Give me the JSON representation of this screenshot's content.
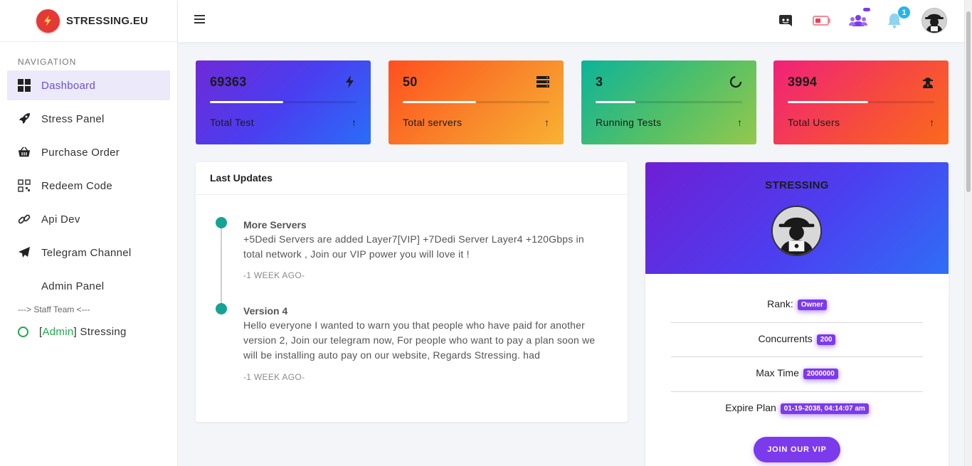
{
  "brand": {
    "name": "STRESSING.EU",
    "logo_icon": "lightning-icon",
    "logo_color": "#e53935"
  },
  "nav": {
    "title": "NAVIGATION",
    "items": [
      {
        "label": "Dashboard",
        "icon": "grid-icon",
        "active": true
      },
      {
        "label": "Stress Panel",
        "icon": "rocket-icon"
      },
      {
        "label": "Purchase Order",
        "icon": "basket-icon"
      },
      {
        "label": "Redeem Code",
        "icon": "qr-icon"
      },
      {
        "label": "Api Dev",
        "icon": "link-icon"
      },
      {
        "label": "Telegram Channel",
        "icon": "paper-plane-icon"
      },
      {
        "label": "Admin Panel",
        "icon": ""
      }
    ],
    "staff_title": "---> Staff Team <---",
    "staff_member": {
      "prefix_open": "[",
      "role": "Admin",
      "prefix_close": "]",
      "name": " Stressing",
      "status_color": "#20a84a"
    }
  },
  "topbar": {
    "icons": [
      "discord-icon",
      "battery-icon",
      "users-icon",
      "bell-icon",
      "avatar"
    ],
    "notification_count": "1"
  },
  "stats": [
    {
      "value": "69363",
      "label": "Total Test",
      "icon": "bolt-icon",
      "progress": 0.5
    },
    {
      "value": "50",
      "label": "Total servers",
      "icon": "server-icon",
      "progress": 0.5
    },
    {
      "value": "3",
      "label": "Running Tests",
      "icon": "spinner-icon",
      "progress": 0.27
    },
    {
      "value": "3994",
      "label": "Total Users",
      "icon": "spy-icon",
      "progress": 0.55
    }
  ],
  "stat_arrow": "↑",
  "updates": {
    "title": "Last Updates",
    "items": [
      {
        "title": "More Servers",
        "body": "+5Dedi Servers are added Layer7[VIP] +7Dedi Server Layer4 +120Gbps in total network , Join our VIP power you will love it !",
        "time": "-1 WEEK AGO-"
      },
      {
        "title": "Version 4",
        "body": "Hello everyone I wanted to warn you that people who have paid for another version 2, Join our telegram now, For people who want to pay a plan soon we will be installing auto pay on our website, Regards Stressing. had",
        "time": "-1 WEEK AGO-"
      }
    ]
  },
  "profile": {
    "name": "STRESSING",
    "rank_label": "Rank:",
    "rank_value": "Owner",
    "concurrents_label": "Concurrents",
    "concurrents_value": "200",
    "maxtime_label": "Max Time",
    "maxtime_value": "2000000",
    "expire_label": "Expire Plan",
    "expire_value": "01-19-2038, 04:14:07 am",
    "button": "JOIN OUR VIP"
  },
  "colors": {
    "accent": "#7c3aed",
    "active_nav_bg": "#ece9fa",
    "timeline_dot": "#16a394"
  }
}
